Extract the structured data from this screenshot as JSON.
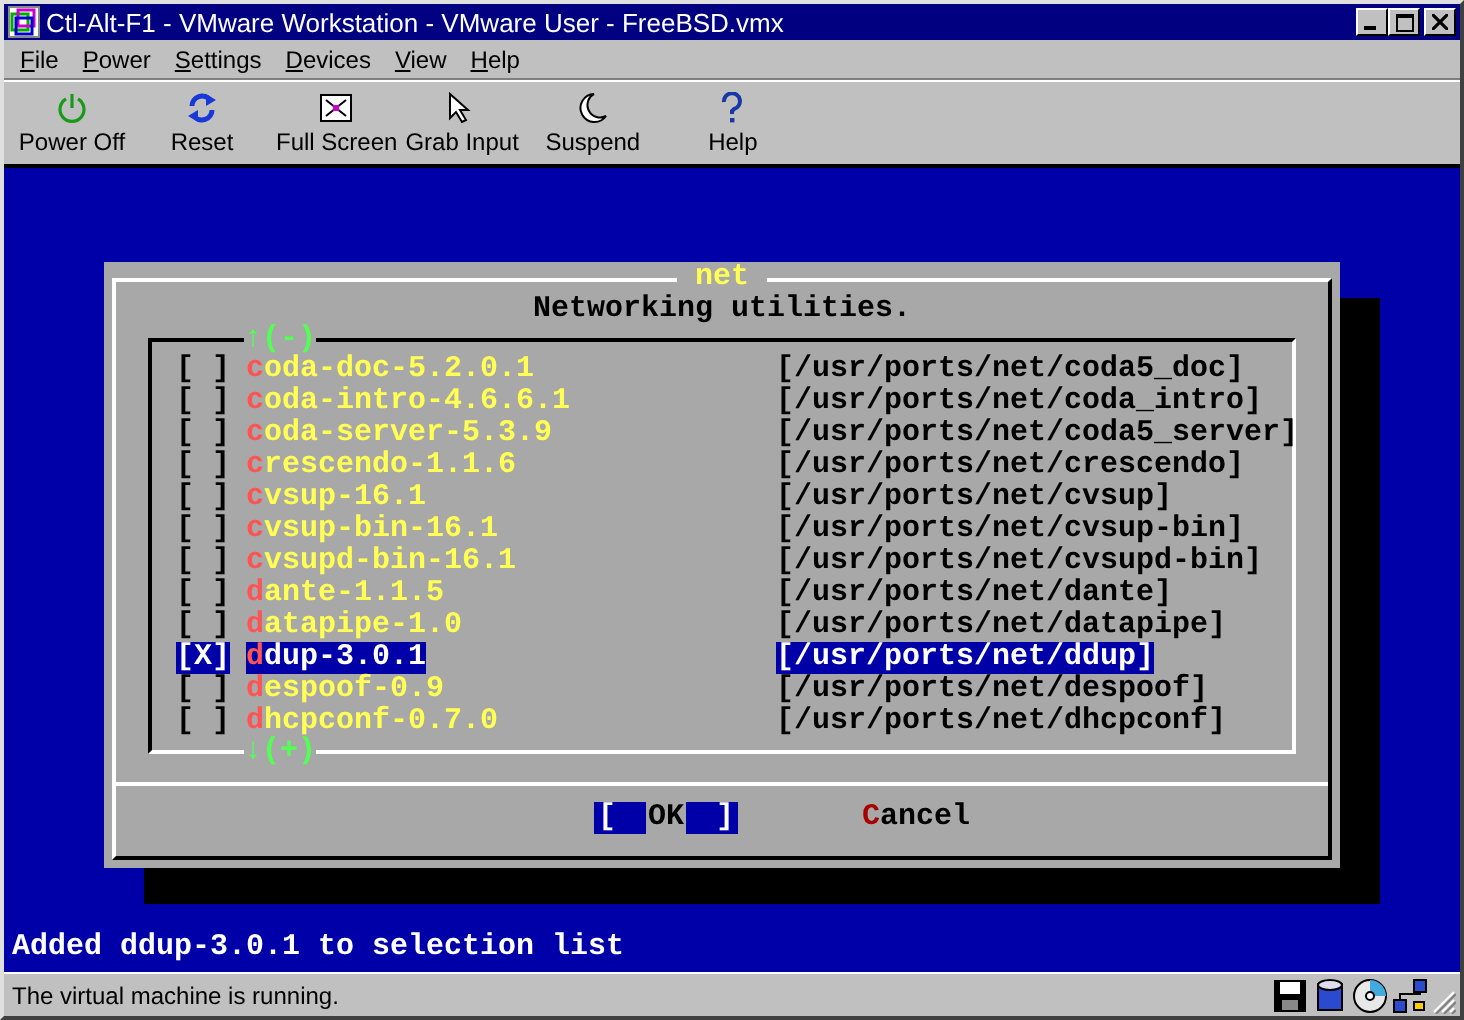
{
  "window": {
    "title": "Ctl-Alt-F1 - VMware Workstation - VMware User - FreeBSD.vmx"
  },
  "menu": [
    {
      "label": "File"
    },
    {
      "label": "Power"
    },
    {
      "label": "Settings"
    },
    {
      "label": "Devices"
    },
    {
      "label": "View"
    },
    {
      "label": "Help"
    }
  ],
  "toolbar": [
    {
      "kind": "power",
      "label": "Power Off"
    },
    {
      "kind": "reset",
      "label": "Reset"
    },
    {
      "kind": "fullscreen",
      "label": "Full Screen"
    },
    {
      "kind": "grab",
      "label": "Grab Input"
    },
    {
      "kind": "suspend",
      "label": "Suspend"
    },
    {
      "kind": "help",
      "label": "Help"
    }
  ],
  "dialog": {
    "title": "net",
    "heading": "Networking utilities.",
    "scroll_up": "↑(-)",
    "scroll_down": "↓(+)",
    "items": [
      {
        "mark": "[ ]",
        "name": "coda-doc-5.2.0.1",
        "path": "[/usr/ports/net/coda5_doc]",
        "selected": false
      },
      {
        "mark": "[ ]",
        "name": "coda-intro-4.6.6.1",
        "path": "[/usr/ports/net/coda_intro]",
        "selected": false
      },
      {
        "mark": "[ ]",
        "name": "coda-server-5.3.9",
        "path": "[/usr/ports/net/coda5_server]",
        "selected": false
      },
      {
        "mark": "[ ]",
        "name": "crescendo-1.1.6",
        "path": "[/usr/ports/net/crescendo]",
        "selected": false
      },
      {
        "mark": "[ ]",
        "name": "cvsup-16.1",
        "path": "[/usr/ports/net/cvsup]",
        "selected": false
      },
      {
        "mark": "[ ]",
        "name": "cvsup-bin-16.1",
        "path": "[/usr/ports/net/cvsup-bin]",
        "selected": false
      },
      {
        "mark": "[ ]",
        "name": "cvsupd-bin-16.1",
        "path": "[/usr/ports/net/cvsupd-bin]",
        "selected": false
      },
      {
        "mark": "[ ]",
        "name": "dante-1.1.5",
        "path": "[/usr/ports/net/dante]",
        "selected": false
      },
      {
        "mark": "[ ]",
        "name": "datapipe-1.0",
        "path": "[/usr/ports/net/datapipe]",
        "selected": false
      },
      {
        "mark": "[X]",
        "name": "ddup-3.0.1",
        "path": "[/usr/ports/net/ddup]",
        "selected": true
      },
      {
        "mark": "[ ]",
        "name": "despoof-0.9",
        "path": "[/usr/ports/net/despoof]",
        "selected": false
      },
      {
        "mark": "[ ]",
        "name": "dhcpconf-0.7.0",
        "path": "[/usr/ports/net/dhcpconf]",
        "selected": false
      }
    ],
    "buttons": [
      {
        "open": "[",
        "label": "OK",
        "close": "]",
        "selected": true
      },
      {
        "label": "Cancel",
        "selected": false
      }
    ]
  },
  "console_message": "Added ddup-3.0.1 to selection list",
  "status_bar": {
    "text": "The virtual machine is running."
  }
}
